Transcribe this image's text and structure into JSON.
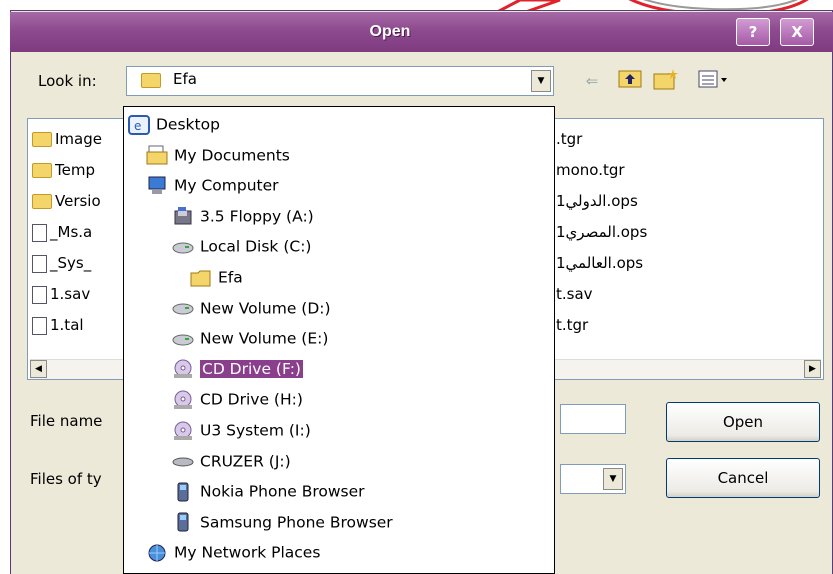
{
  "window": {
    "title": "Open",
    "help_label": "?",
    "close_label": "X"
  },
  "look_in": {
    "label": "Look in:",
    "value": "Efa"
  },
  "file_list": {
    "left_items": [
      "Image",
      "Temp",
      "Versio",
      "_Ms.a",
      "_Sys_",
      "1.sav",
      "1.tal"
    ],
    "right_items": [
      ".tgr",
      "mono.tgr",
      "1الدولي.ops",
      "1المصري.ops",
      "1العالمي.ops",
      "t.sav",
      "t.tgr"
    ]
  },
  "file_name": {
    "label": "File name",
    "value": ""
  },
  "files_of_type": {
    "label": "Files of ty",
    "value": ""
  },
  "buttons": {
    "open": "Open",
    "cancel": "Cancel"
  },
  "look_in_dropdown": {
    "items": [
      {
        "label": "Desktop",
        "icon": "desktop-icon",
        "indent": 0,
        "selected": false
      },
      {
        "label": "My Documents",
        "icon": "my-documents-icon",
        "indent": 1,
        "selected": false
      },
      {
        "label": "My Computer",
        "icon": "my-computer-icon",
        "indent": 1,
        "selected": false
      },
      {
        "label": "3.5 Floppy (A:)",
        "icon": "floppy-icon",
        "indent": 2,
        "selected": false
      },
      {
        "label": "Local Disk (C:)",
        "icon": "hard-disk-icon",
        "indent": 2,
        "selected": false
      },
      {
        "label": "Efa",
        "icon": "folder-icon",
        "indent": 3,
        "selected": false
      },
      {
        "label": "New Volume (D:)",
        "icon": "hard-disk-icon",
        "indent": 2,
        "selected": false
      },
      {
        "label": "New Volume (E:)",
        "icon": "hard-disk-icon",
        "indent": 2,
        "selected": false
      },
      {
        "label": "CD Drive (F:)",
        "icon": "cd-drive-icon",
        "indent": 2,
        "selected": true
      },
      {
        "label": "CD Drive (H:)",
        "icon": "cd-drive-icon",
        "indent": 2,
        "selected": false
      },
      {
        "label": "U3 System (I:)",
        "icon": "cd-drive-icon",
        "indent": 2,
        "selected": false
      },
      {
        "label": "CRUZER (J:)",
        "icon": "removable-drive-icon",
        "indent": 2,
        "selected": false
      },
      {
        "label": "Nokia Phone Browser",
        "icon": "phone-icon",
        "indent": 2,
        "selected": false
      },
      {
        "label": "Samsung Phone Browser",
        "icon": "phone-icon",
        "indent": 2,
        "selected": false
      },
      {
        "label": "My Network Places",
        "icon": "network-icon",
        "indent": 1,
        "selected": false
      }
    ]
  },
  "colors": {
    "title_bar": "#8e4a8f",
    "selection": "#8a3f8c",
    "dialog_bg": "#ece9d8",
    "balloon_border": "#e0222a"
  }
}
